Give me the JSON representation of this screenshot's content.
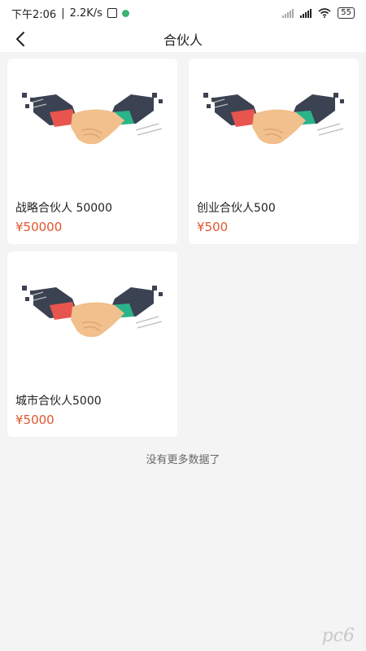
{
  "status_bar": {
    "time": "下午2:06",
    "speed": "2.2K/s",
    "battery": "55"
  },
  "header": {
    "title": "合伙人"
  },
  "products": [
    {
      "title": "战略合伙人 50000",
      "price": "¥50000"
    },
    {
      "title": "创业合伙人500",
      "price": "¥500"
    },
    {
      "title": "城市合伙人5000",
      "price": "¥5000"
    }
  ],
  "footer": {
    "no_more": "没有更多数据了"
  },
  "watermark": "pc6",
  "colors": {
    "price": "#e0572f",
    "cuff_red": "#e8554f",
    "cuff_green": "#2bb38a",
    "sleeve": "#3b4252",
    "hand": "#f1c08c"
  }
}
